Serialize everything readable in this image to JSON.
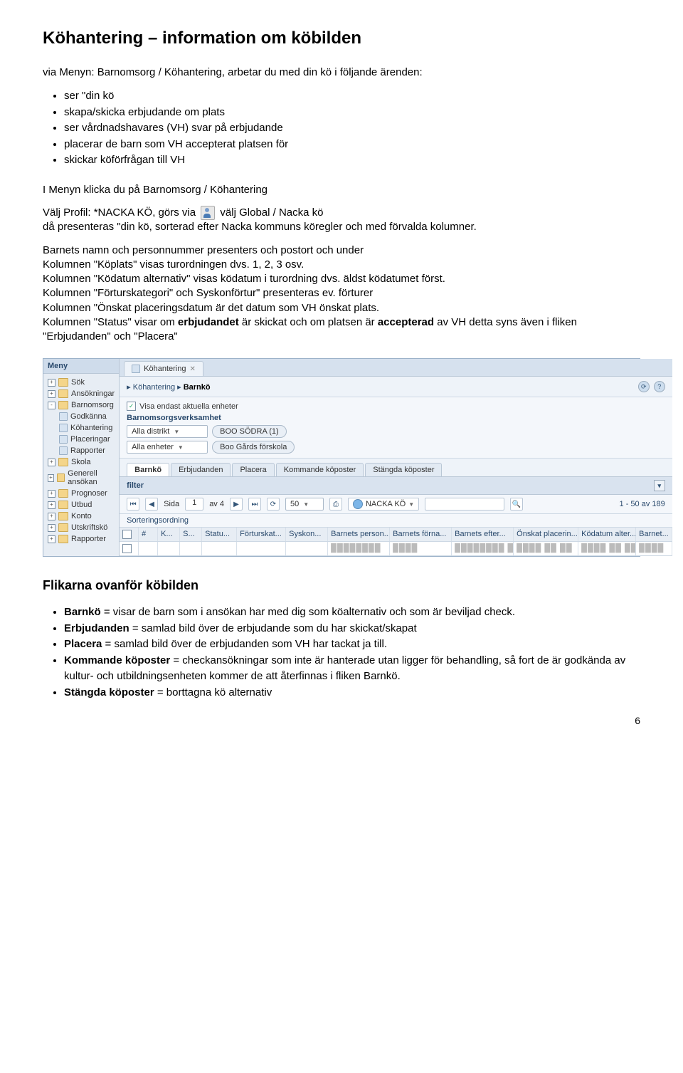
{
  "title": "Köhantering – information om köbilden",
  "intro": "via Menyn: Barnomsorg / Köhantering, arbetar du med din kö i följande ärenden:",
  "bullets1": [
    "ser \"din kö",
    "skapa/skicka erbjudande om plats",
    "ser vårdnadshavares (VH) svar på erbjudande",
    "placerar de barn som VH accepterat platsen för",
    "skickar köförfrågan till VH"
  ],
  "line1": "I Menyn klicka du på Barnomsorg  / Köhantering",
  "profile_pre": "Välj Profil: *NACKA KÖ, görs via ",
  "profile_post": " välj Global  / Nacka kö",
  "line2": "då presenteras \"din kö, sorterad efter Nacka kommuns köregler och med förvalda kolumner.",
  "para2a": "Barnets namn och personnummer presenters och postort och under",
  "para2b": "Kolumnen \"Köplats\" visas turordningen dvs. 1, 2, 3 osv.",
  "para2c": "Kolumnen \"Ködatum alternativ\" visas ködatum i turordning dvs. äldst ködatumet först.",
  "para2d": "Kolumnen \"Förturskategori\" och Syskonförtur\" presenteras ev. förturer",
  "para2e": "Kolumnen \"Önskat placeringsdatum är det datum som VH önskat plats.",
  "para2f_1": "Kolumnen \"Status\" visar om ",
  "para2f_b1": "erbjudandet",
  "para2f_2": " är skickat och om platsen är ",
  "para2f_b2": "accepterad",
  "para2f_3": " av VH detta syns även i fliken \"Erbjudanden\" och \"Placera\"",
  "h2": "Flikarna ovanför köbilden",
  "bullets2": [
    {
      "b": "Barnkö",
      "t": " = visar de barn som i ansökan har med dig som köalternativ och som är beviljad check."
    },
    {
      "b": "Erbjudanden",
      "t": " = samlad bild över de erbjudande som du har skickat/skapat"
    },
    {
      "b": "Placera",
      "t": " = samlad bild över de erbjudanden som VH har tackat ja till."
    },
    {
      "b": "Kommande köposter",
      "t": " = checkansökningar som inte är hanterade utan ligger för behandling, så fort de är godkända av kultur- och utbildningsenheten kommer de att återfinnas i fliken Barnkö."
    },
    {
      "b": "Stängda köposter ",
      "t": " = borttagna kö alternativ"
    }
  ],
  "page_number": "6",
  "app": {
    "sidebar_header": "Meny",
    "tree": [
      {
        "exp": "+",
        "type": "folder",
        "label": "Sök"
      },
      {
        "exp": "+",
        "type": "folder",
        "label": "Ansökningar"
      },
      {
        "exp": "-",
        "type": "folder",
        "label": "Barnomsorg"
      },
      {
        "child": true,
        "type": "leaf",
        "label": "Godkänna"
      },
      {
        "child": true,
        "type": "leaf",
        "label": "Köhantering"
      },
      {
        "child": true,
        "type": "leaf",
        "label": "Placeringar"
      },
      {
        "child": true,
        "type": "leaf",
        "label": "Rapporter"
      },
      {
        "exp": "+",
        "type": "folder",
        "label": "Skola"
      },
      {
        "exp": "+",
        "type": "folder",
        "label": "Generell ansökan"
      },
      {
        "exp": "+",
        "type": "folder",
        "label": "Prognoser"
      },
      {
        "exp": "+",
        "type": "folder",
        "label": "Utbud"
      },
      {
        "exp": "+",
        "type": "folder",
        "label": "Konto"
      },
      {
        "exp": "+",
        "type": "folder",
        "label": "Utskriftskö"
      },
      {
        "exp": "+",
        "type": "folder",
        "label": "Rapporter"
      }
    ],
    "tab_label": "Köhantering",
    "bc1": "Köhantering",
    "bc2": "Barnkö",
    "chk_label": "Visa endast aktuella enheter",
    "section_label": "Barnomsorgsverksamhet",
    "distrikt_label": "Alla distrikt",
    "distrikt_val": "BOO SÖDRA (1)",
    "enheter_label": "Alla enheter",
    "enheter_val": "Boo Gårds förskola",
    "tabs2": [
      "Barnkö",
      "Erbjudanden",
      "Placera",
      "Kommande köposter",
      "Stängda köposter"
    ],
    "filter_label": "filter",
    "page_word": "Sida",
    "page_cur": "1",
    "page_of": "av 4",
    "pagesize": "50",
    "profile": "NACKA KÖ",
    "result_count": "1 - 50 av 189",
    "sort_label": "Sorteringsordning",
    "columns": {
      "n": "#",
      "k": "K...",
      "s": "S...",
      "stat": "Statu...",
      "fort": "Förturskat...",
      "sysk": "Syskon...",
      "pers": "Barnets person...",
      "forn": "Barnets förna...",
      "efter": "Barnets efter...",
      "onsk": "Önskat placerin...",
      "kodat": "Ködatum alter...",
      "barn": "Barnet..."
    },
    "row": {
      "pers": "████████",
      "forn": "████",
      "efter": "████████ ██",
      "onsk": "████ ██ ██",
      "kodat": "████ ██ ██",
      "barn": "████"
    }
  }
}
